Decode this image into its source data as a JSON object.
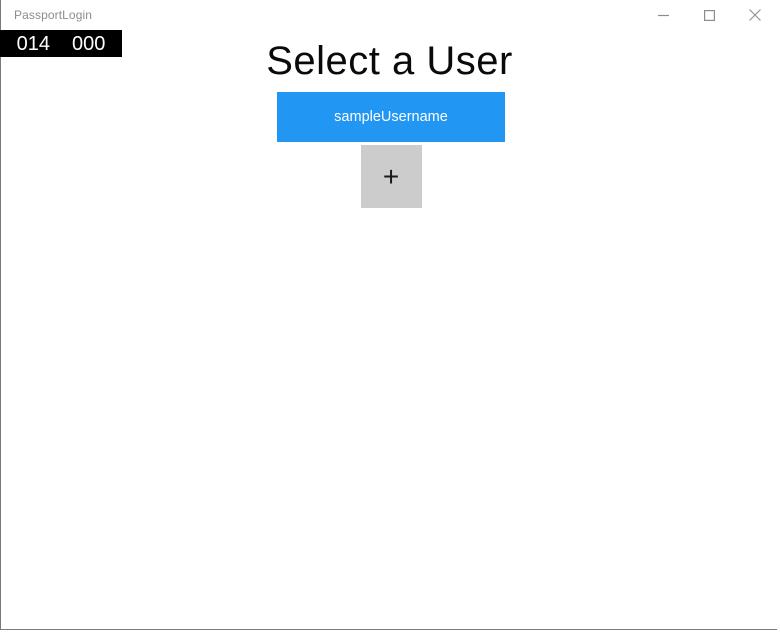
{
  "window": {
    "title": "PassportLogin",
    "controls": {
      "minimize_label": "Minimize",
      "maximize_label": "Maximize",
      "close_label": "Close"
    }
  },
  "overlay": {
    "counter_primary": "014",
    "counter_secondary": "000",
    "background_color": "#000000",
    "text_color": "#ffffff"
  },
  "main": {
    "heading": "Select a User",
    "users": [
      {
        "name": "sampleUsername",
        "background_color": "#2196f3",
        "text_color": "#ffffff"
      }
    ],
    "add_user": {
      "glyph": "+",
      "background_color": "#cccccc"
    }
  }
}
